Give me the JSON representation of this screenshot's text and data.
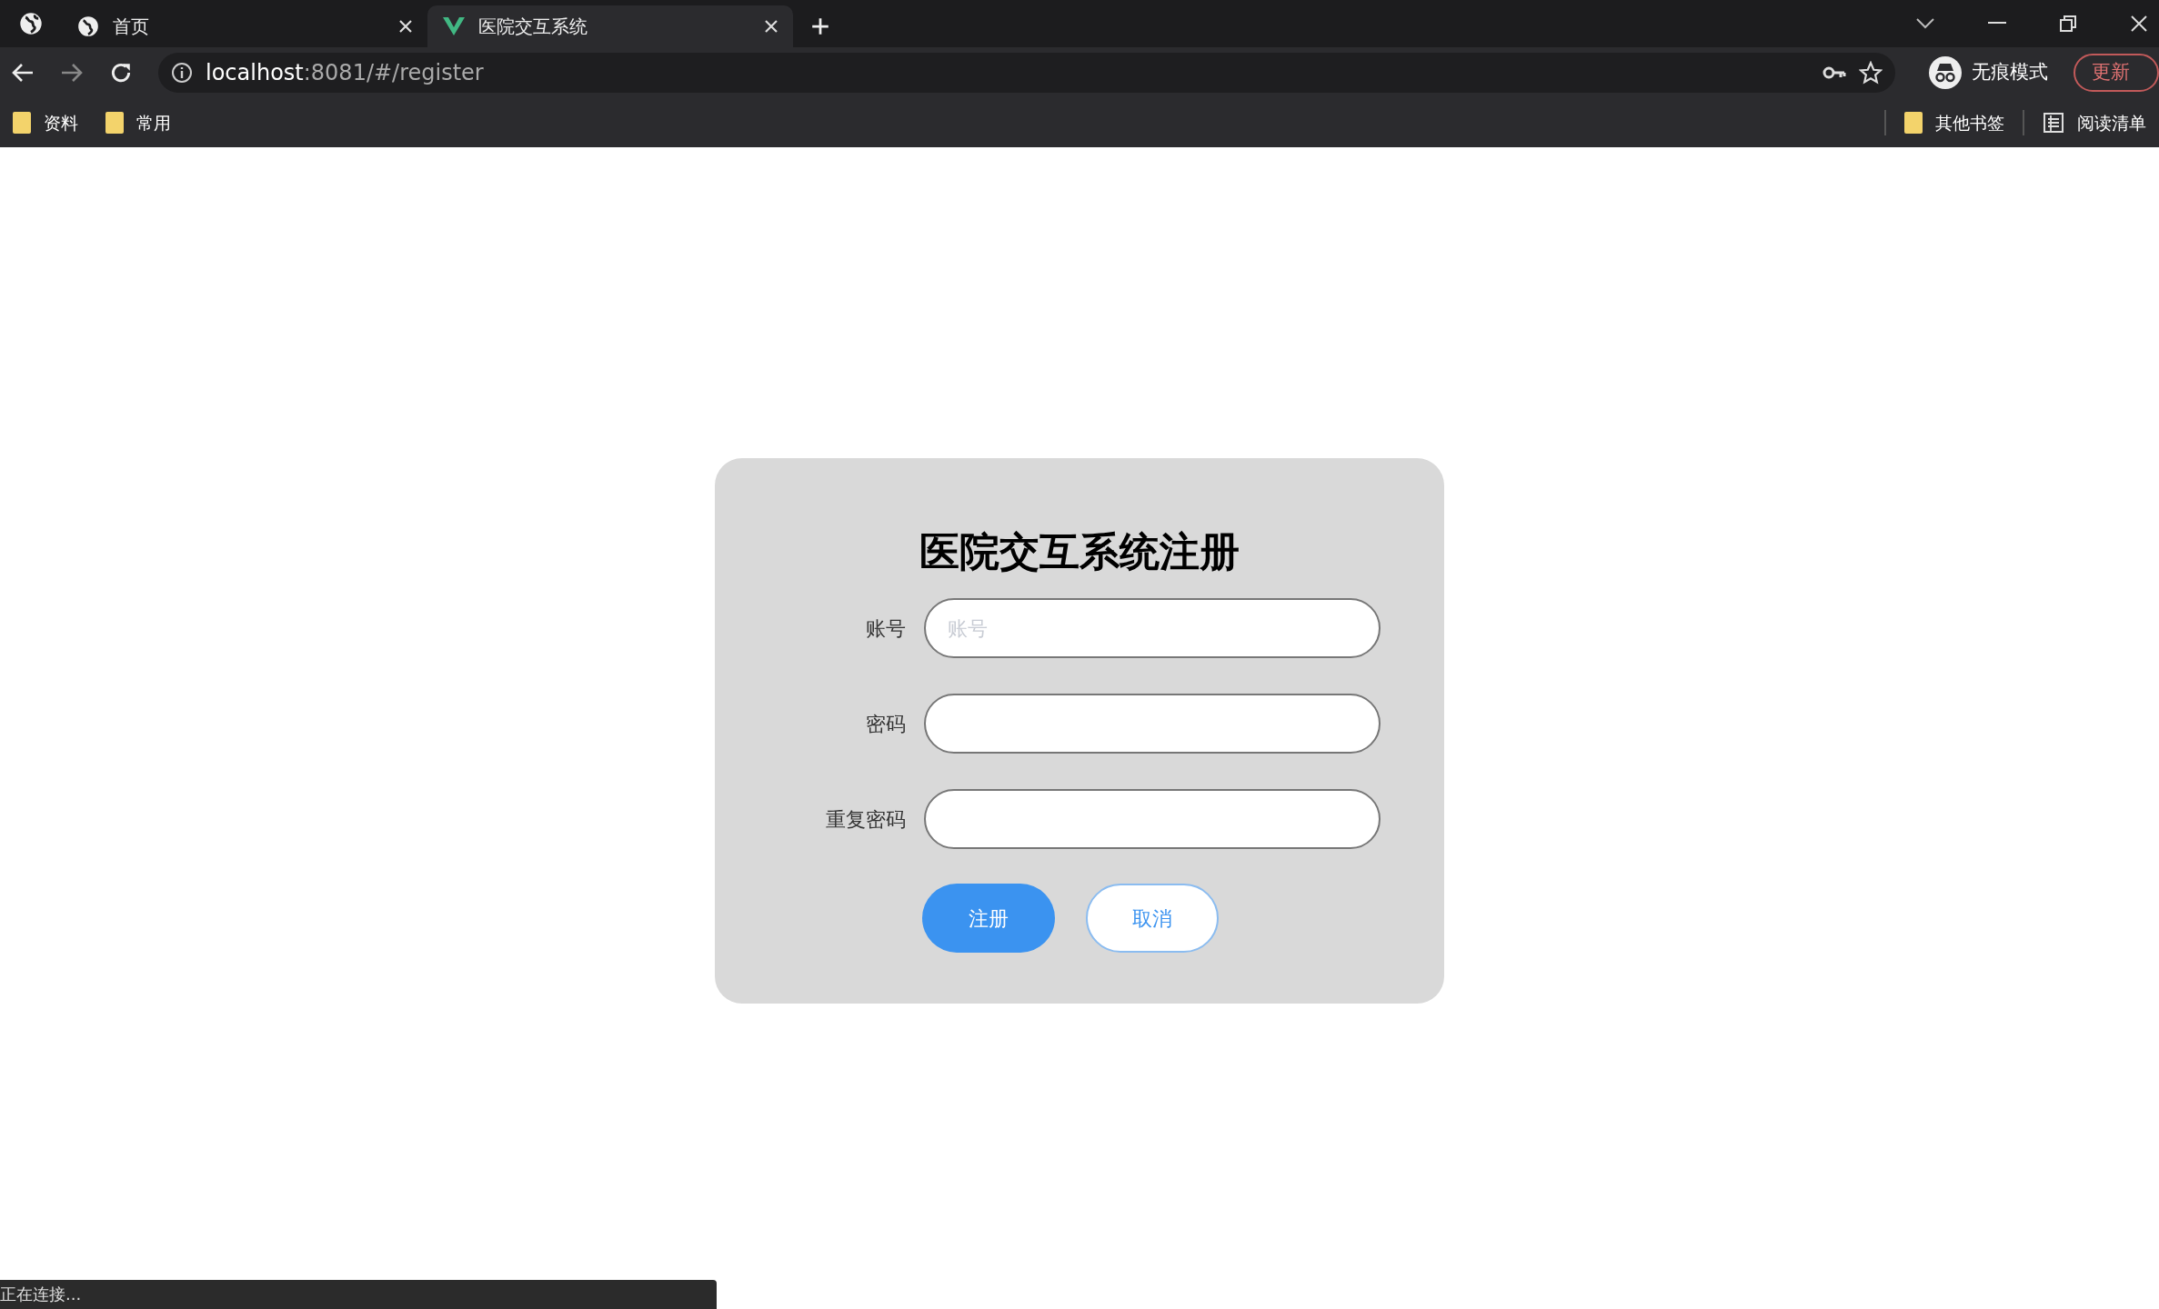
{
  "browser": {
    "tabs": [
      {
        "title": "首页",
        "selected": false
      },
      {
        "title": "医院交互系统",
        "selected": true
      }
    ],
    "address": {
      "host": "localhost",
      "rest": ":8081/#/register"
    },
    "profile": "无痕模式",
    "update_button": "更新",
    "bookmarks": [
      "资料",
      "常用"
    ],
    "other_bookmarks": "其他书签",
    "reading_list": "阅读清单"
  },
  "form": {
    "title": "医院交互系统注册",
    "fields": [
      {
        "label": "账号",
        "placeholder": "账号"
      },
      {
        "label": "密码"
      },
      {
        "label": "重复密码"
      }
    ],
    "buttons": [
      {
        "label": "注册",
        "kind": "primary"
      },
      {
        "label": "取消",
        "kind": "secondary"
      }
    ]
  },
  "status_bar": "正在连接..."
}
